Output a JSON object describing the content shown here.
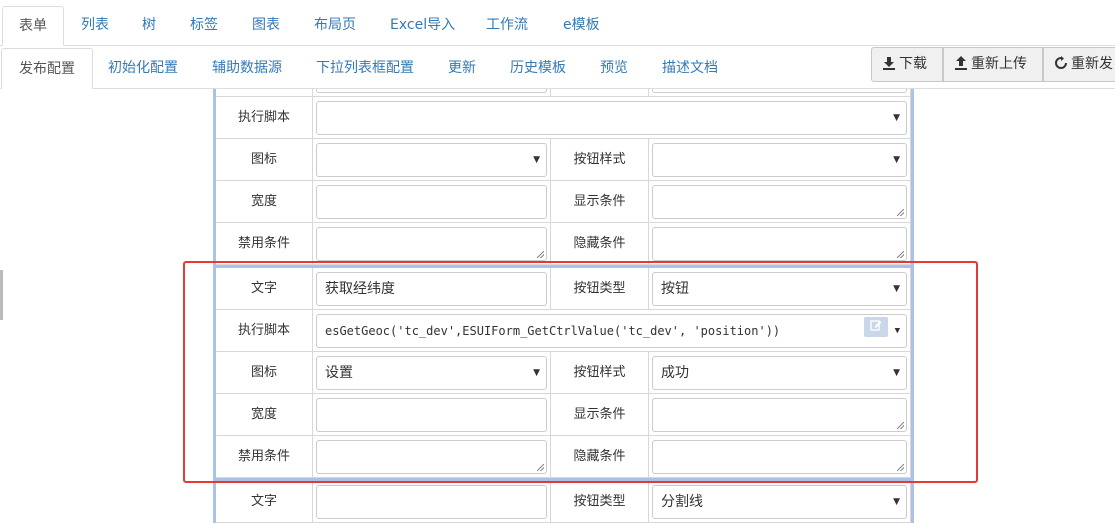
{
  "tabs_primary": [
    {
      "label": "表单",
      "active": true
    },
    {
      "label": "列表"
    },
    {
      "label": "树"
    },
    {
      "label": "标签"
    },
    {
      "label": "图表"
    },
    {
      "label": "布局页"
    },
    {
      "label": "Excel导入"
    },
    {
      "label": "工作流"
    },
    {
      "label": "e模板"
    }
  ],
  "tabs_secondary": [
    {
      "label": "发布配置",
      "active": true
    },
    {
      "label": "初始化配置"
    },
    {
      "label": "辅助数据源"
    },
    {
      "label": "下拉列表框配置"
    },
    {
      "label": "更新"
    },
    {
      "label": "历史模板"
    },
    {
      "label": "预览"
    },
    {
      "label": "描述文档"
    }
  ],
  "toolbar": {
    "download_label": "下载",
    "reupload_label": "重新上传",
    "republish_label": "重新发"
  },
  "labels": {
    "script": "执行脚本",
    "icon": "图标",
    "button_style": "按钮样式",
    "width": "宽度",
    "show_condition": "显示条件",
    "disable_condition": "禁用条件",
    "hide_condition": "隐藏条件",
    "text": "文字",
    "button_type": "按钮类型"
  },
  "group1": {
    "script": "",
    "icon": "",
    "button_style": "",
    "width": "",
    "show_condition": "",
    "disable_condition": "",
    "hide_condition": ""
  },
  "group2": {
    "text": "获取经纬度",
    "button_type": "按钮",
    "script": "esGetGeoc('tc_dev',ESUIForm_GetCtrlValue('tc_dev', 'position'))",
    "icon": "设置",
    "button_style": "成功",
    "width": "",
    "show_condition": "",
    "disable_condition": "",
    "hide_condition": ""
  },
  "group3": {
    "text": "",
    "button_type": "分割线"
  },
  "colors": {
    "tab_link": "#337ab7",
    "group_border": "#a9c2e5",
    "highlight": "#e53935"
  }
}
